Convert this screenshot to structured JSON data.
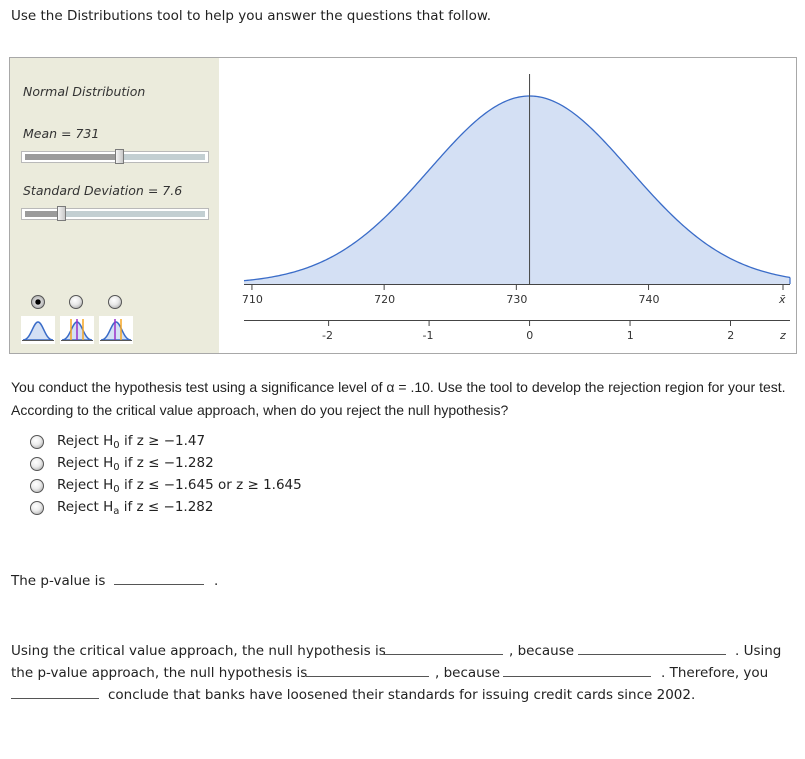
{
  "intro": "Use the Distributions tool to help you answer the questions that follow.",
  "tool": {
    "distribution_label": "Normal Distribution",
    "mean_label": "Mean = 731",
    "sd_label": "Standard Deviation = 7.6",
    "mean_slider_fraction": 0.52,
    "sd_slider_fraction": 0.2,
    "modes": [
      {
        "name": "plain-curve",
        "selected": true
      },
      {
        "name": "two-tailed-region",
        "selected": false
      },
      {
        "name": "one-tailed-region",
        "selected": false
      }
    ],
    "colors": {
      "panel_bg": "#ebebdc",
      "curve_fill": "#d4e0f4",
      "curve_line": "#3a6cc8",
      "tail_orange": "#f5a623",
      "tail_purple": "#9b30c8"
    }
  },
  "chart_data": {
    "type": "area",
    "distribution": "normal",
    "mean": 731,
    "sd": 7.6,
    "xlim": [
      709.4,
      750.7
    ],
    "x_axis": {
      "label": "x̄",
      "ticks": [
        710,
        720,
        730,
        740
      ]
    },
    "z_axis": {
      "label": "z",
      "ticks": [
        -2,
        -1,
        0,
        1,
        2
      ]
    },
    "marker_line_at": 731,
    "grid": false
  },
  "question": {
    "text": "You conduct the hypothesis test using a significance level of α = .10. Use the tool to develop the rejection region for your test. According to the critical value approach, when do you reject the null hypothesis?",
    "options": [
      {
        "pre": "Reject H",
        "sub": "0",
        "post": " if z ≥ −1.47"
      },
      {
        "pre": "Reject H",
        "sub": "0",
        "post": " if z ≤ −1.282"
      },
      {
        "pre": "Reject H",
        "sub": "0",
        "post": " if z ≤ −1.645 or z ≥ 1.645"
      },
      {
        "pre": "Reject H",
        "sub": "a",
        "post": " if z ≤ −1.282"
      }
    ]
  },
  "pvalue": {
    "label": "The p-value is",
    "end": ".",
    "value": ""
  },
  "conclusion": {
    "l1_a": "Using the critical value approach, the null hypothesis is",
    "l1_b": ", because",
    "l1_c": ". Using",
    "l2_a": "the p-value approach, the null hypothesis is",
    "l2_b": ", because",
    "l2_c": ". Therefore, you",
    "l3": "conclude that banks have loosened their standards for issuing credit cards since 2002.",
    "blanks": [
      "",
      "",
      "",
      "",
      ""
    ]
  }
}
